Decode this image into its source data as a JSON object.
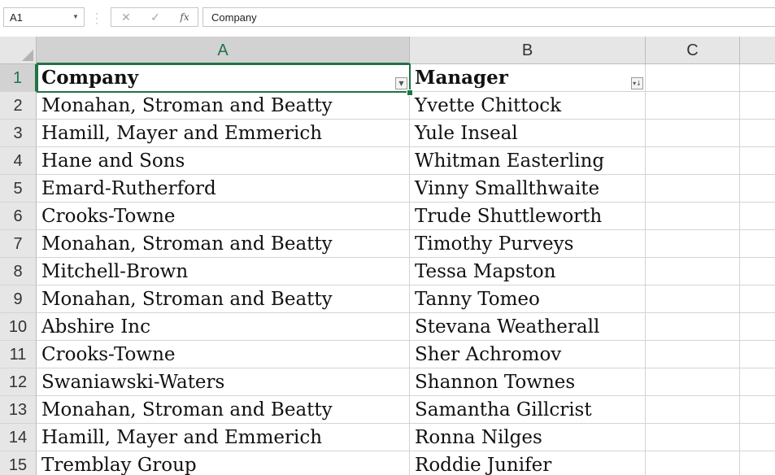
{
  "formula_bar": {
    "name_box": "A1",
    "fx_label": "fx",
    "formula_value": "Company"
  },
  "columns": [
    {
      "label": "A"
    },
    {
      "label": "B"
    },
    {
      "label": "C"
    }
  ],
  "rows": [
    {
      "num": "1",
      "company": "Company",
      "manager": "Manager"
    },
    {
      "num": "2",
      "company": "Monahan, Stroman and Beatty",
      "manager": "Yvette Chittock"
    },
    {
      "num": "3",
      "company": "Hamill, Mayer and Emmerich",
      "manager": "Yule Inseal"
    },
    {
      "num": "4",
      "company": "Hane and Sons",
      "manager": "Whitman Easterling"
    },
    {
      "num": "5",
      "company": "Emard-Rutherford",
      "manager": "Vinny Smallthwaite"
    },
    {
      "num": "6",
      "company": "Crooks-Towne",
      "manager": "Trude Shuttleworth"
    },
    {
      "num": "7",
      "company": "Monahan, Stroman and Beatty",
      "manager": "Timothy Purveys"
    },
    {
      "num": "8",
      "company": "Mitchell-Brown",
      "manager": "Tessa Mapston"
    },
    {
      "num": "9",
      "company": "Monahan, Stroman and Beatty",
      "manager": "Tanny Tomeo"
    },
    {
      "num": "10",
      "company": "Abshire Inc",
      "manager": "Stevana Weatherall"
    },
    {
      "num": "11",
      "company": "Crooks-Towne",
      "manager": "Sher Achromov"
    },
    {
      "num": "12",
      "company": "Swaniawski-Waters",
      "manager": "Shannon Townes"
    },
    {
      "num": "13",
      "company": "Monahan, Stroman and Beatty",
      "manager": "Samantha Gillcrist"
    },
    {
      "num": "14",
      "company": "Hamill, Mayer and Emmerich",
      "manager": "Ronna Nilges"
    },
    {
      "num": "15",
      "company": "Tremblay Group",
      "manager": "Roddie Junifer"
    }
  ],
  "colors": {
    "accent": "#217346",
    "header_bg": "#e6e6e6",
    "gridline": "#d4d4d4"
  },
  "icons": {
    "name_box_dropdown": "chevron-down-icon",
    "cancel": "close-icon",
    "enter": "check-icon",
    "function": "fx-icon",
    "filter_company": "filter-dropdown-icon",
    "filter_manager": "filter-sort-descending-icon"
  }
}
